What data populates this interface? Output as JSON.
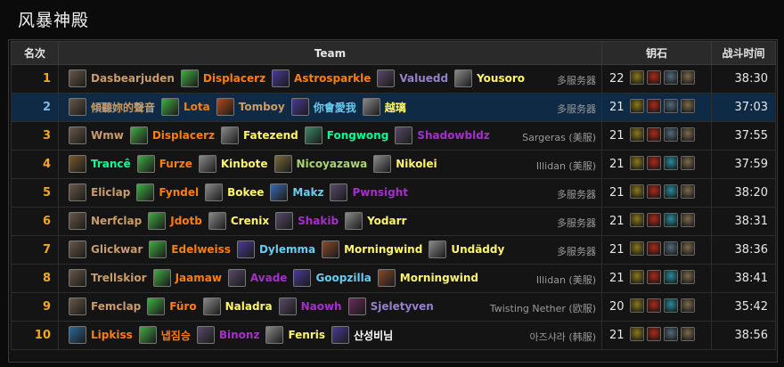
{
  "title": "风暴神殿",
  "headers": {
    "rank": "名次",
    "team": "Team",
    "key": "钥石",
    "time": "战斗时间"
  },
  "rows": [
    {
      "rank": "1",
      "server": "多服务器",
      "level": "22",
      "time": "38:30",
      "highlight": false,
      "members": [
        {
          "name": "Dasbearjuden",
          "class": "c-warrior",
          "spec_icon": "shield-spec-icon",
          "icon_color": "#6b5a48"
        },
        {
          "name": "Displacerz",
          "class": "c-druid",
          "spec_icon": "leaf-spec-icon",
          "icon_color": "#3fae3f"
        },
        {
          "name": "Astrosparkle",
          "class": "c-druid",
          "spec_icon": "starfall-spec-icon",
          "icon_color": "#4a3b9a"
        },
        {
          "name": "Valuedd",
          "class": "c-warlock",
          "spec_icon": "demon-spec-icon",
          "icon_color": "#5a4a6a"
        },
        {
          "name": "Yousoro",
          "class": "c-rogue",
          "spec_icon": "dagger-spec-icon",
          "icon_color": "#8a8a8a"
        }
      ],
      "affixes": [
        {
          "icon": "tyrannical-icon",
          "color": "#8a7a1a"
        },
        {
          "icon": "bolstering-icon",
          "color": "#aa2a1a"
        },
        {
          "icon": "grievous-icon",
          "color": "#556a7a"
        },
        {
          "icon": "infested-icon",
          "color": "#7a6a4a"
        }
      ]
    },
    {
      "rank": "2",
      "server": "多服务器",
      "level": "21",
      "time": "37:03",
      "highlight": true,
      "members": [
        {
          "name": "傾聽妳的聲音",
          "class": "c-warrior",
          "spec_icon": "shield-spec-icon",
          "icon_color": "#6b5a48"
        },
        {
          "name": "Lota",
          "class": "c-druid",
          "spec_icon": "leaf-spec-icon",
          "icon_color": "#3fae3f"
        },
        {
          "name": "Tomboy",
          "class": "c-warrior",
          "spec_icon": "fury-spec-icon",
          "icon_color": "#b04a1a"
        },
        {
          "name": "你會愛我",
          "class": "c-mage",
          "spec_icon": "frost-spec-icon",
          "icon_color": "#4a3b9a"
        },
        {
          "name": "越璃",
          "class": "c-rogue",
          "spec_icon": "dagger-spec-icon",
          "icon_color": "#8a8a8a"
        }
      ],
      "affixes": [
        {
          "icon": "tyrannical-icon",
          "color": "#8a7a1a"
        },
        {
          "icon": "bolstering-icon",
          "color": "#aa2a1a"
        },
        {
          "icon": "grievous-icon",
          "color": "#556a7a"
        },
        {
          "icon": "infested-icon",
          "color": "#7a6a4a"
        }
      ]
    },
    {
      "rank": "3",
      "server": "Sargeras (美服)",
      "level": "21",
      "time": "37:55",
      "highlight": false,
      "members": [
        {
          "name": "Wmw",
          "class": "c-warrior",
          "spec_icon": "shield-spec-icon",
          "icon_color": "#6b5a48"
        },
        {
          "name": "Displacerz",
          "class": "c-druid",
          "spec_icon": "leaf-spec-icon",
          "icon_color": "#3fae3f"
        },
        {
          "name": "Fatezend",
          "class": "c-rogue",
          "spec_icon": "dagger-spec-icon",
          "icon_color": "#8a8a8a"
        },
        {
          "name": "Fongwong",
          "class": "c-monk",
          "spec_icon": "monk-spec-icon",
          "icon_color": "#3a8a6a"
        },
        {
          "name": "Shadowbldz",
          "class": "c-dh",
          "spec_icon": "demon-spec-icon",
          "icon_color": "#5a4a6a"
        }
      ],
      "affixes": [
        {
          "icon": "tyrannical-icon",
          "color": "#8a7a1a"
        },
        {
          "icon": "bolstering-icon",
          "color": "#aa2a1a"
        },
        {
          "icon": "grievous-icon",
          "color": "#556a7a"
        },
        {
          "icon": "infested-icon",
          "color": "#7a6a4a"
        }
      ]
    },
    {
      "rank": "4",
      "server": "Illidan (美服)",
      "level": "21",
      "time": "37:59",
      "highlight": false,
      "members": [
        {
          "name": "Trancê",
          "class": "c-monk",
          "spec_icon": "brewmaster-spec-icon",
          "icon_color": "#7a5a2a"
        },
        {
          "name": "Furze",
          "class": "c-druid",
          "spec_icon": "leaf-spec-icon",
          "icon_color": "#3fae3f"
        },
        {
          "name": "Kinbote",
          "class": "c-rogue",
          "spec_icon": "dagger-spec-icon",
          "icon_color": "#8a8a8a"
        },
        {
          "name": "Nicoyazawa",
          "class": "c-hunter",
          "spec_icon": "hunter-spec-icon",
          "icon_color": "#7a6a3a"
        },
        {
          "name": "Nikolei",
          "class": "c-rogue",
          "spec_icon": "dagger-spec-icon",
          "icon_color": "#8a8a8a"
        }
      ],
      "affixes": [
        {
          "icon": "fortified-icon",
          "color": "#8a7a1a"
        },
        {
          "icon": "raging-icon",
          "color": "#aa2a1a"
        },
        {
          "icon": "quaking-icon",
          "color": "#2a8a9a"
        },
        {
          "icon": "infested-icon",
          "color": "#7a6a4a"
        }
      ]
    },
    {
      "rank": "5",
      "server": "多服务器",
      "level": "21",
      "time": "38:20",
      "highlight": false,
      "members": [
        {
          "name": "Eliclap",
          "class": "c-warrior",
          "spec_icon": "shield-spec-icon",
          "icon_color": "#6b5a48"
        },
        {
          "name": "Fyndel",
          "class": "c-druid",
          "spec_icon": "leaf-spec-icon",
          "icon_color": "#3fae3f"
        },
        {
          "name": "Bokee",
          "class": "c-rogue",
          "spec_icon": "dagger-spec-icon",
          "icon_color": "#8a8a8a"
        },
        {
          "name": "Makz",
          "class": "c-mage",
          "spec_icon": "arcane-spec-icon",
          "icon_color": "#3a6ab0"
        },
        {
          "name": "Pwnsight",
          "class": "c-dh",
          "spec_icon": "demon-spec-icon",
          "icon_color": "#5a4a6a"
        }
      ],
      "affixes": [
        {
          "icon": "fortified-icon",
          "color": "#8a7a1a"
        },
        {
          "icon": "raging-icon",
          "color": "#aa2a1a"
        },
        {
          "icon": "quaking-icon",
          "color": "#2a8a9a"
        },
        {
          "icon": "infested-icon",
          "color": "#7a6a4a"
        }
      ]
    },
    {
      "rank": "6",
      "server": "多服务器",
      "level": "21",
      "time": "38:31",
      "highlight": false,
      "members": [
        {
          "name": "Nerfclap",
          "class": "c-warrior",
          "spec_icon": "shield-spec-icon",
          "icon_color": "#6b5a48"
        },
        {
          "name": "Jdotb",
          "class": "c-druid",
          "spec_icon": "leaf-spec-icon",
          "icon_color": "#3fae3f"
        },
        {
          "name": "Crenix",
          "class": "c-rogue",
          "spec_icon": "dagger-spec-icon",
          "icon_color": "#8a8a8a"
        },
        {
          "name": "Shakib",
          "class": "c-dh",
          "spec_icon": "demon-spec-icon",
          "icon_color": "#5a4a6a"
        },
        {
          "name": "Yodarr",
          "class": "c-rogue",
          "spec_icon": "dagger-spec-icon",
          "icon_color": "#8a8a8a"
        }
      ],
      "affixes": [
        {
          "icon": "fortified-icon",
          "color": "#8a7a1a"
        },
        {
          "icon": "raging-icon",
          "color": "#aa2a1a"
        },
        {
          "icon": "quaking-icon",
          "color": "#2a8a9a"
        },
        {
          "icon": "infested-icon",
          "color": "#7a6a4a"
        }
      ]
    },
    {
      "rank": "7",
      "server": "多服务器",
      "level": "21",
      "time": "38:36",
      "highlight": false,
      "members": [
        {
          "name": "Glickwar",
          "class": "c-warrior",
          "spec_icon": "shield-spec-icon",
          "icon_color": "#6b5a48"
        },
        {
          "name": "Edelweiss",
          "class": "c-druid",
          "spec_icon": "leaf-spec-icon",
          "icon_color": "#3fae3f"
        },
        {
          "name": "Dylemma",
          "class": "c-mage",
          "spec_icon": "frost-spec-icon",
          "icon_color": "#4a3b9a"
        },
        {
          "name": "Morningwind",
          "class": "c-rogue",
          "spec_icon": "outlaw-spec-icon",
          "icon_color": "#8a4a2a"
        },
        {
          "name": "Undäddy",
          "class": "c-rogue",
          "spec_icon": "dagger-spec-icon",
          "icon_color": "#8a8a8a"
        }
      ],
      "affixes": [
        {
          "icon": "tyrannical-icon",
          "color": "#8a7a1a"
        },
        {
          "icon": "bolstering-icon",
          "color": "#aa2a1a"
        },
        {
          "icon": "grievous-icon",
          "color": "#556a7a"
        },
        {
          "icon": "infested-icon",
          "color": "#7a6a4a"
        }
      ]
    },
    {
      "rank": "8",
      "server": "Illidan (美服)",
      "level": "21",
      "time": "38:41",
      "highlight": false,
      "members": [
        {
          "name": "Trellskior",
          "class": "c-warrior",
          "spec_icon": "shield-spec-icon",
          "icon_color": "#6b5a48"
        },
        {
          "name": "Jaamaw",
          "class": "c-druid",
          "spec_icon": "leaf-spec-icon",
          "icon_color": "#3fae3f"
        },
        {
          "name": "Avade",
          "class": "c-dh",
          "spec_icon": "demon-spec-icon",
          "icon_color": "#5a4a6a"
        },
        {
          "name": "Goopzilla",
          "class": "c-mage",
          "spec_icon": "frost-spec-icon",
          "icon_color": "#4a3b9a"
        },
        {
          "name": "Morningwind",
          "class": "c-rogue",
          "spec_icon": "outlaw-spec-icon",
          "icon_color": "#8a4a2a"
        }
      ],
      "affixes": [
        {
          "icon": "fortified-icon",
          "color": "#8a7a1a"
        },
        {
          "icon": "raging-icon",
          "color": "#aa2a1a"
        },
        {
          "icon": "quaking-icon",
          "color": "#2a8a9a"
        },
        {
          "icon": "infested-icon",
          "color": "#7a6a4a"
        }
      ]
    },
    {
      "rank": "9",
      "server": "Twisting Nether (欧服)",
      "level": "20",
      "time": "35:42",
      "highlight": false,
      "members": [
        {
          "name": "Femclap",
          "class": "c-warrior",
          "spec_icon": "shield-spec-icon",
          "icon_color": "#6b5a48"
        },
        {
          "name": "Füro",
          "class": "c-druid",
          "spec_icon": "leaf-spec-icon",
          "icon_color": "#3fae3f"
        },
        {
          "name": "Naladra",
          "class": "c-rogue",
          "spec_icon": "dagger-spec-icon",
          "icon_color": "#8a8a8a"
        },
        {
          "name": "Naowh",
          "class": "c-dh",
          "spec_icon": "demon-spec-icon",
          "icon_color": "#5a4a6a"
        },
        {
          "name": "Sjeletyven",
          "class": "c-warlock",
          "spec_icon": "warlock-spec-icon",
          "icon_color": "#6a2a5a"
        }
      ],
      "affixes": [
        {
          "icon": "fortified-icon",
          "color": "#8a7a1a"
        },
        {
          "icon": "raging-icon",
          "color": "#aa2a1a"
        },
        {
          "icon": "quaking-icon",
          "color": "#2a8a9a"
        },
        {
          "icon": "infested-icon",
          "color": "#7a6a4a"
        }
      ]
    },
    {
      "rank": "10",
      "server": "아즈샤라 (韩服)",
      "level": "21",
      "time": "38:56",
      "highlight": false,
      "members": [
        {
          "name": "Lipkiss",
          "class": "c-druid",
          "spec_icon": "guardian-spec-icon",
          "icon_color": "#2a6a9a"
        },
        {
          "name": "냅짐승",
          "class": "c-druid",
          "spec_icon": "leaf-spec-icon",
          "icon_color": "#3fae3f"
        },
        {
          "name": "Binonz",
          "class": "c-dh",
          "spec_icon": "demon-spec-icon",
          "icon_color": "#5a4a6a"
        },
        {
          "name": "Fenris",
          "class": "c-rogue",
          "spec_icon": "dagger-spec-icon",
          "icon_color": "#8a8a8a"
        },
        {
          "name": "산성비님",
          "class": "c-priest",
          "spec_icon": "frost-spec-icon",
          "icon_color": "#4a3b9a"
        }
      ],
      "affixes": [
        {
          "icon": "tyrannical-icon",
          "color": "#8a7a1a"
        },
        {
          "icon": "bolstering-icon",
          "color": "#aa2a1a"
        },
        {
          "icon": "grievous-icon",
          "color": "#556a7a"
        },
        {
          "icon": "infested-icon",
          "color": "#7a6a4a"
        }
      ]
    }
  ]
}
